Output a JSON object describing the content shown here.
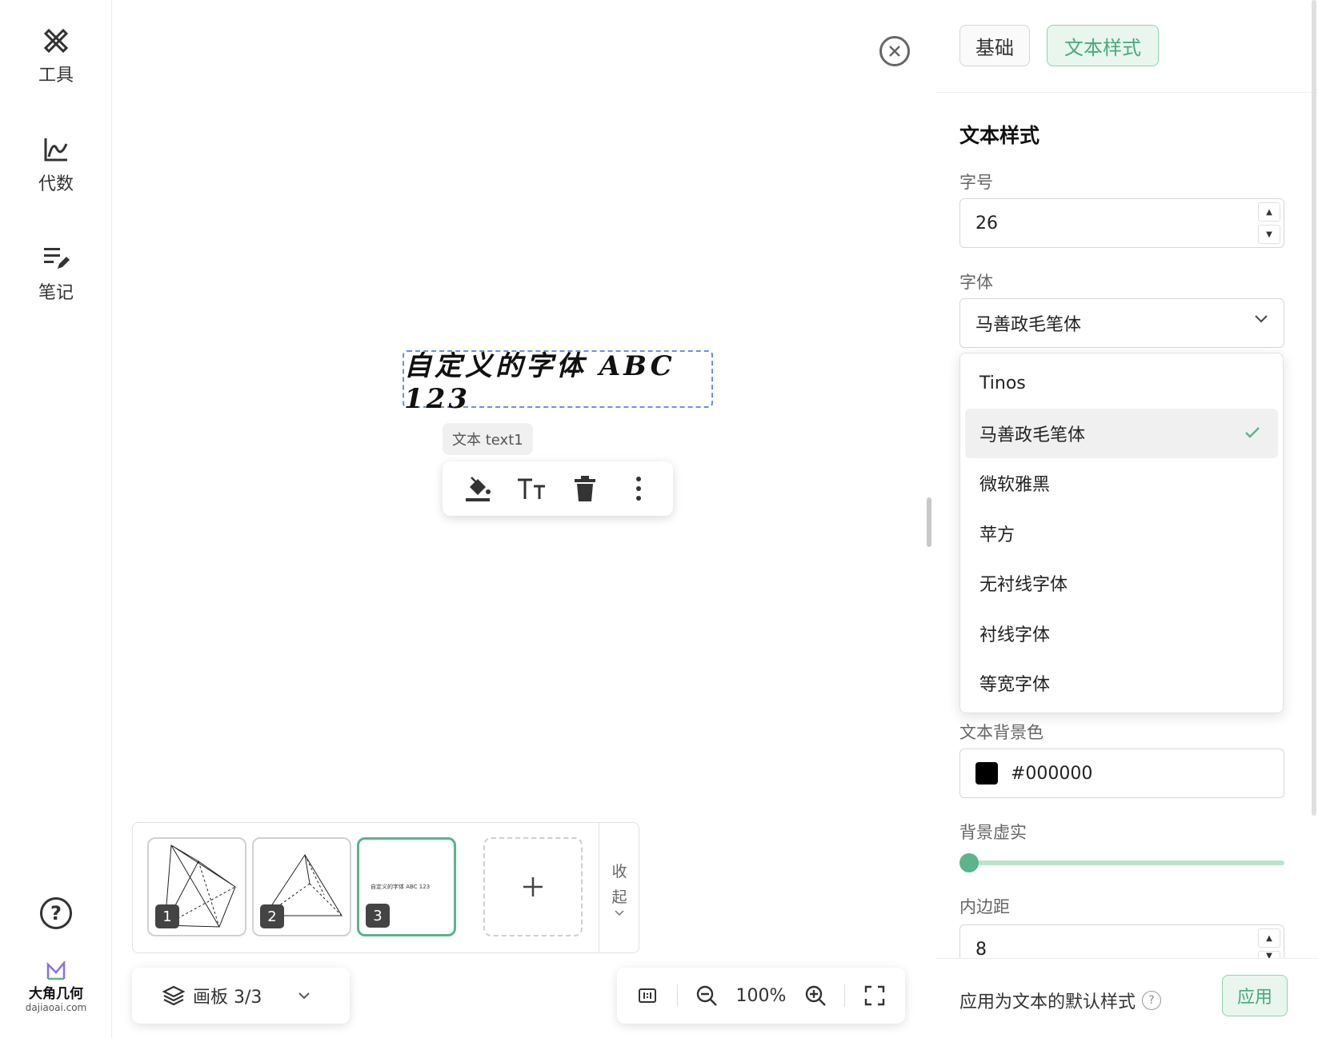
{
  "sidebar": {
    "items": [
      {
        "label": "工具",
        "icon": "tools-icon"
      },
      {
        "label": "代数",
        "icon": "algebra-icon"
      },
      {
        "label": "笔记",
        "icon": "notes-icon"
      }
    ],
    "help_icon": "?",
    "logo": {
      "name": "大角几何",
      "domain": "dajiaoai.com"
    }
  },
  "canvas": {
    "text_object": "自定义的字体 ABC 123",
    "object_tag": "文本 text1",
    "toolbar": [
      "fill-icon",
      "font-size-icon",
      "trash-icon",
      "more-icon"
    ]
  },
  "boards": {
    "items": [
      {
        "num": "1",
        "active": false
      },
      {
        "num": "2",
        "active": false
      },
      {
        "num": "3",
        "active": true,
        "preview_text": "自定义的字体 ABC 123"
      }
    ],
    "collapse_label": [
      "收",
      "起"
    ]
  },
  "board_select": {
    "label": "画板 3/3"
  },
  "zoom": {
    "value": "100%"
  },
  "panel": {
    "tabs": [
      {
        "label": "基础",
        "active": false
      },
      {
        "label": "文本样式",
        "active": true
      }
    ],
    "section_title": "文本样式",
    "font_size": {
      "label": "字号",
      "value": "26"
    },
    "font_family": {
      "label": "字体",
      "value": "马善政毛笔体",
      "options": [
        "Tinos",
        "马善政毛笔体",
        "微软雅黑",
        "苹方",
        "无衬线字体",
        "衬线字体",
        "等宽字体"
      ],
      "selected_index": 1
    },
    "bg_color": {
      "label": "文本背景色",
      "value": "#000000"
    },
    "bg_opacity": {
      "label": "背景虚实",
      "value": 0
    },
    "padding": {
      "label": "内边距",
      "value": "8"
    },
    "footer": {
      "label": "应用为文本的默认样式",
      "apply": "应用"
    }
  },
  "colors": {
    "accent": "#5bb48a",
    "accent_light": "#e8f6ee",
    "selection": "#6a8fe8"
  }
}
